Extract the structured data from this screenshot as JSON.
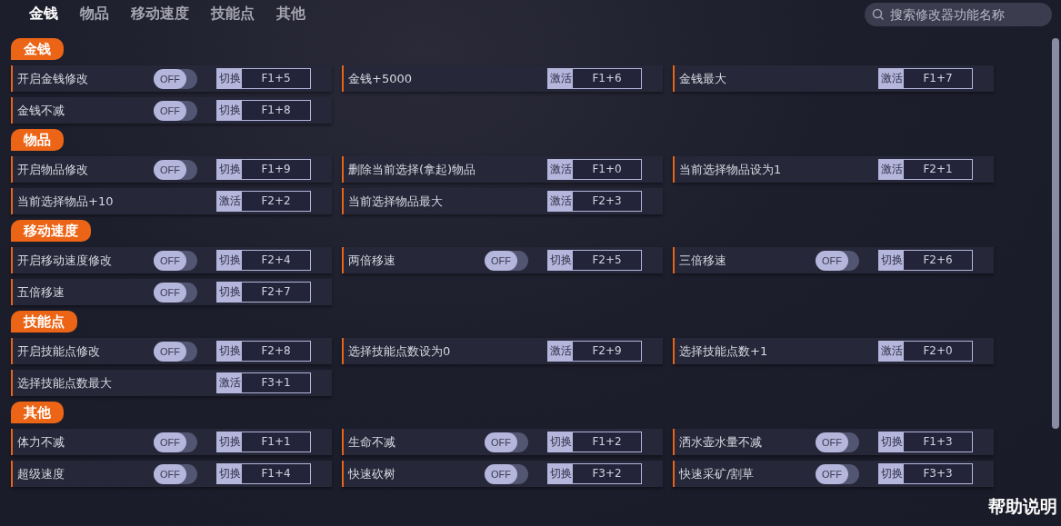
{
  "tabs": [
    {
      "label": "金钱",
      "selected": true
    },
    {
      "label": "物品",
      "selected": false
    },
    {
      "label": "移动速度",
      "selected": false
    },
    {
      "label": "技能点",
      "selected": false
    },
    {
      "label": "其他",
      "selected": false
    }
  ],
  "search": {
    "placeholder": "搜索修改器功能名称"
  },
  "sections": [
    {
      "title": "金钱",
      "items": [
        {
          "label": "开启金钱修改",
          "kind": "toggle",
          "on": false,
          "switch_text": "OFF",
          "action": "切换",
          "key": "F1+5"
        },
        {
          "label": "金钱+5000",
          "kind": "button",
          "action": "激活",
          "key": "F1+6"
        },
        {
          "label": "金钱最大",
          "kind": "button",
          "action": "激活",
          "key": "F1+7"
        },
        {
          "label": "金钱不减",
          "kind": "toggle",
          "on": false,
          "switch_text": "OFF",
          "action": "切换",
          "key": "F1+8"
        }
      ]
    },
    {
      "title": "物品",
      "items": [
        {
          "label": "开启物品修改",
          "kind": "toggle",
          "on": false,
          "switch_text": "OFF",
          "action": "切换",
          "key": "F1+9"
        },
        {
          "label": "删除当前选择(拿起)物品",
          "kind": "button",
          "action": "激活",
          "key": "F1+0"
        },
        {
          "label": "当前选择物品设为1",
          "kind": "button",
          "action": "激活",
          "key": "F2+1"
        },
        {
          "label": "当前选择物品+10",
          "kind": "button",
          "action": "激活",
          "key": "F2+2"
        },
        {
          "label": "当前选择物品最大",
          "kind": "button",
          "action": "激活",
          "key": "F2+3"
        }
      ]
    },
    {
      "title": "移动速度",
      "items": [
        {
          "label": "开启移动速度修改",
          "kind": "toggle",
          "on": false,
          "switch_text": "OFF",
          "action": "切换",
          "key": "F2+4"
        },
        {
          "label": "两倍移速",
          "kind": "toggle",
          "on": false,
          "switch_text": "OFF",
          "action": "切换",
          "key": "F2+5"
        },
        {
          "label": "三倍移速",
          "kind": "toggle",
          "on": false,
          "switch_text": "OFF",
          "action": "切换",
          "key": "F2+6"
        },
        {
          "label": "五倍移速",
          "kind": "toggle",
          "on": false,
          "switch_text": "OFF",
          "action": "切换",
          "key": "F2+7"
        }
      ]
    },
    {
      "title": "技能点",
      "items": [
        {
          "label": "开启技能点修改",
          "kind": "toggle",
          "on": false,
          "switch_text": "OFF",
          "action": "切换",
          "key": "F2+8"
        },
        {
          "label": "选择技能点数设为0",
          "kind": "button",
          "action": "激活",
          "key": "F2+9"
        },
        {
          "label": "选择技能点数+1",
          "kind": "button",
          "action": "激活",
          "key": "F2+0"
        },
        {
          "label": "选择技能点数最大",
          "kind": "button",
          "action": "激活",
          "key": "F3+1"
        }
      ]
    },
    {
      "title": "其他",
      "items": [
        {
          "label": "体力不减",
          "kind": "toggle",
          "on": false,
          "switch_text": "OFF",
          "action": "切换",
          "key": "F1+1"
        },
        {
          "label": "生命不减",
          "kind": "toggle",
          "on": false,
          "switch_text": "OFF",
          "action": "切换",
          "key": "F1+2"
        },
        {
          "label": "洒水壶水量不减",
          "kind": "toggle",
          "on": false,
          "switch_text": "OFF",
          "action": "切换",
          "key": "F1+3"
        },
        {
          "label": "超级速度",
          "kind": "toggle",
          "on": false,
          "switch_text": "OFF",
          "action": "切换",
          "key": "F1+4"
        },
        {
          "label": "快速砍树",
          "kind": "toggle",
          "on": false,
          "switch_text": "OFF",
          "action": "切换",
          "key": "F3+2"
        },
        {
          "label": "快速采矿/割草",
          "kind": "toggle",
          "on": false,
          "switch_text": "OFF",
          "action": "切换",
          "key": "F3+3"
        }
      ]
    }
  ],
  "help": "帮助说明"
}
